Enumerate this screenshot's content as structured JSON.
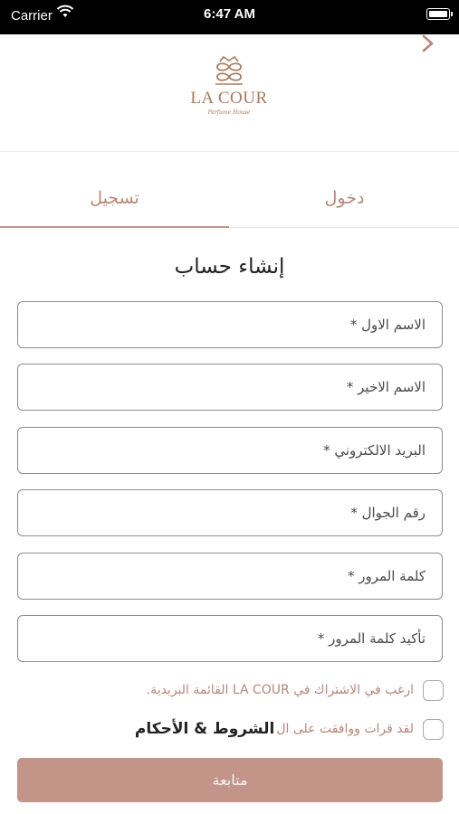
{
  "status_bar": {
    "carrier": "Carrier",
    "time": "6:47 AM"
  },
  "brand": {
    "name": "LA COUR",
    "tagline": "Perfume House"
  },
  "tabs": {
    "register": "تسجيل",
    "login": "دخول"
  },
  "form": {
    "title": "إنشاء حساب",
    "fields": [
      {
        "placeholder": "الاسم الاول  *"
      },
      {
        "placeholder": "الاسم الاخير  *"
      },
      {
        "placeholder": "البريد الالكتروني  *"
      },
      {
        "placeholder": "رقم الجوال  *"
      },
      {
        "placeholder": "كلمة المرور  *"
      },
      {
        "placeholder": "تأكيد كلمة المرور  *"
      }
    ],
    "newsletter_label": "ارغب في الاشتراك في LA COUR القائمة البريدية.",
    "terms_prefix": "لقد قرات ووافقت على ال",
    "terms_link": "الشروط & الأحكام",
    "submit_label": "متابعة"
  },
  "colors": {
    "accent": "#c39589",
    "accent_text": "#b9867a",
    "logo": "#a87c5e"
  },
  "icons": {
    "back": "chevron-right-icon",
    "wifi": "wifi-icon",
    "battery": "battery-icon",
    "logo": "crown-logo-icon"
  }
}
